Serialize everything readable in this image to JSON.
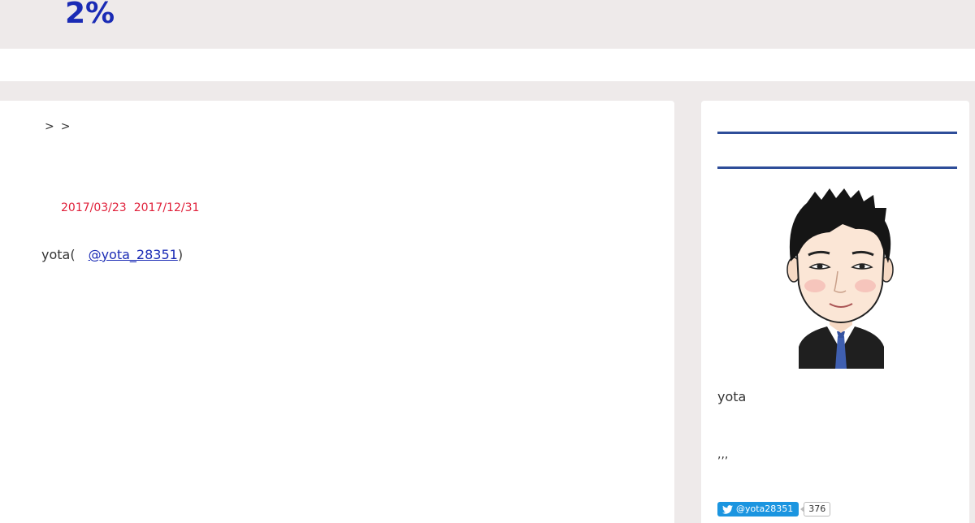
{
  "header": {
    "site_title": "2%"
  },
  "breadcrumb": {
    "sep1": ">",
    "sep2": ">"
  },
  "post": {
    "published_date": "2017/03/23",
    "updated_date": "2017/12/31",
    "author_prefix": "yota(",
    "author_handle": "@yota_28351",
    "author_suffix": ")"
  },
  "sidebar": {
    "profile_name": "yota",
    "profile_desc": ",,,",
    "follow_button_label": "@yota28351",
    "follower_count": "376"
  },
  "colors": {
    "title_blue": "#1a2bb5",
    "date_red": "#e0203a",
    "divider_blue": "#2e4d99",
    "twitter_blue": "#1b95e0"
  },
  "icons": {
    "follow_icon": "twitter-bird-icon"
  }
}
